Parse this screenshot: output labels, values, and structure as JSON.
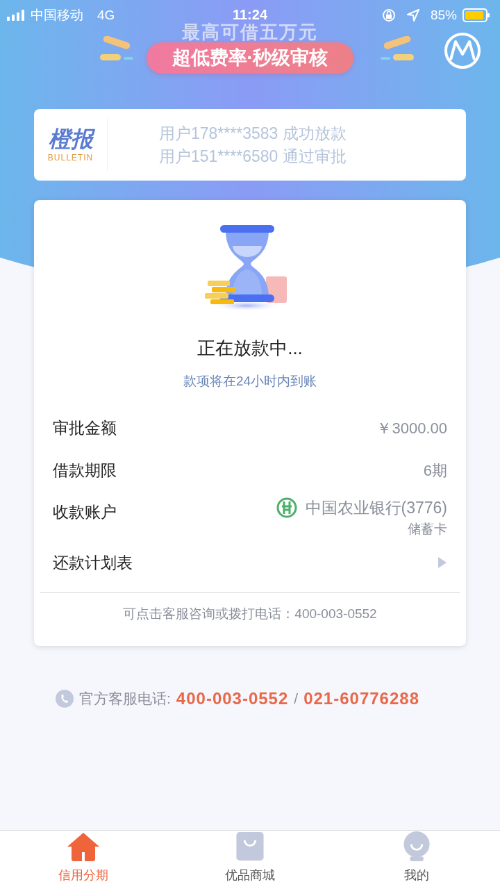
{
  "status_bar": {
    "carrier": "中国移动",
    "network": "4G",
    "time": "11:24",
    "battery": "85%"
  },
  "banner": {
    "headline": "最高可借五万元",
    "slogan": "超低费率·秒级审核"
  },
  "bulletin": {
    "logo_text": "橙报",
    "logo_sub": "BULLETIN",
    "messages": [
      "用户178****3583 成功放款",
      "用户151****6580 通过审批"
    ]
  },
  "status": {
    "title": "正在放款中...",
    "subtitle": "款项将在24小时内到账"
  },
  "details": [
    {
      "kind": "text",
      "label": "审批金额",
      "value": "￥3000.00"
    },
    {
      "kind": "text",
      "label": "借款期限",
      "value": "6期"
    },
    {
      "kind": "bank",
      "label": "收款账户",
      "value": "中国农业银行(3776)",
      "note": "储蓄卡"
    },
    {
      "kind": "link",
      "label": "还款计划表"
    }
  ],
  "hint": "可点击客服咨询或拨打电话：400-003-0552",
  "hotline": {
    "label": "官方客服电话:",
    "numbers": [
      "400-003-0552",
      "021-60776288"
    ],
    "separator": "/"
  },
  "tabs": [
    {
      "label": "信用分期",
      "selected": true
    },
    {
      "label": "优品商城",
      "selected": false
    },
    {
      "label": "我的",
      "selected": false
    }
  ]
}
